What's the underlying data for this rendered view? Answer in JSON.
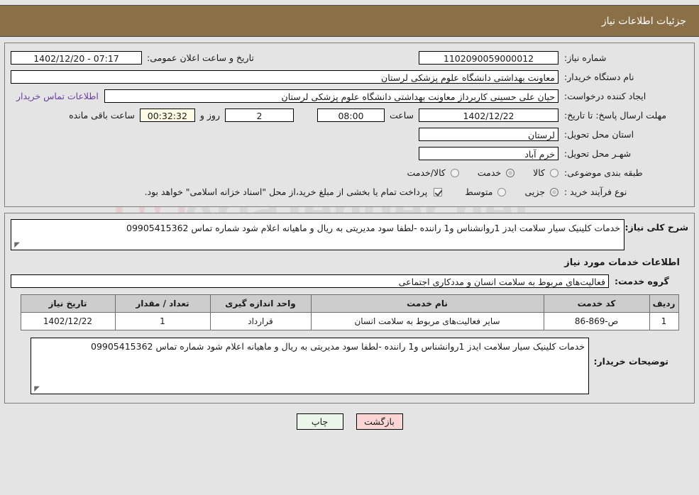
{
  "header": {
    "title": "جزئیات اطلاعات نیاز"
  },
  "form": {
    "need_number_label": "شماره نیاز:",
    "need_number_value": "1102090059000012",
    "announce_label": "تاریخ و ساعت اعلان عمومی:",
    "announce_value": "1402/12/20 - 07:17",
    "buyer_org_label": "نام دستگاه خریدار:",
    "buyer_org_value": "معاونت بهداشتی دانشگاه علوم پزشکی لرستان",
    "creator_label": "ایجاد کننده درخواست:",
    "creator_value": "حیان علی حسینی کاربرداز معاونت بهداشتی دانشگاه علوم پزشکی لرستان",
    "contact_link": "اطلاعات تماس خریدار",
    "deadline_label": "مهلت ارسال پاسخ: تا تاریخ:",
    "deadline_date": "1402/12/22",
    "hour_label": "ساعت",
    "deadline_time": "08:00",
    "days_value": "2",
    "days_label": "روز و",
    "countdown_value": "00:32:32",
    "remaining_label": "ساعت باقی مانده",
    "province_label": "استان محل تحویل:",
    "province_value": "لرستان",
    "city_label": "شهـر محل تحویل:",
    "city_value": "خرم آباد",
    "category_label": "طبقه بندی موضوعی:",
    "category_options": [
      {
        "label": "کالا",
        "selected": false
      },
      {
        "label": "خدمت",
        "selected": true
      },
      {
        "label": "کالا/خدمت",
        "selected": false
      }
    ],
    "process_label": "نوع فرآیند خرید :",
    "process_options": [
      {
        "label": "جزیی",
        "selected": true
      },
      {
        "label": "متوسط",
        "selected": false
      }
    ],
    "treasury_checked": true,
    "treasury_note": "پرداخت تمام یا بخشی از مبلغ خرید،از محل \"اسناد خزانه اسلامی\" خواهد بود."
  },
  "summary": {
    "label": "شرح کلی نیاز:",
    "value": "خدمات کلینیک سیار سلامت ایدز 1روانشناس و1 راننده -لطفا سود مدیریتی به ریال و ماهیانه اعلام شود شماره تماس 09905415362"
  },
  "services_section": {
    "heading": "اطلاعات خدمات مورد نیاز",
    "group_label": "گروه خدمت:",
    "group_value": "فعالیت‌های مربوط به سلامت انسان و مددکاری اجتماعی"
  },
  "table": {
    "columns": [
      "ردیف",
      "کد خدمت",
      "نام خدمت",
      "واحد اندازه گیری",
      "تعداد / مقدار",
      "تاریخ نیاز"
    ],
    "rows": [
      {
        "row_no": "1",
        "service_code": "ص-869-86",
        "service_name": "سایر فعالیت‌های مربوط به سلامت انسان",
        "unit": "قرارداد",
        "quantity": "1",
        "need_date": "1402/12/22"
      }
    ]
  },
  "buyer_notes": {
    "label": "توضیحات خریدار:",
    "value": "خدمات کلینیک سیار سلامت ایدز 1روانشناس و1 راننده -لطفا سود مدیریتی به ریال و ماهیانه اعلام شود شماره تماس 09905415362"
  },
  "footer": {
    "print_label": "چاپ",
    "back_label": "بازگشت"
  },
  "watermark": {
    "text": "AriaTender.net"
  },
  "colors": {
    "header_bg": "#8b6f47",
    "page_bg": "#e4e4e4",
    "link": "#6a3fa0",
    "print_btn": "#eaf6ea",
    "back_btn": "#fcd5d5",
    "countdown_bg": "#fdfbe4"
  }
}
